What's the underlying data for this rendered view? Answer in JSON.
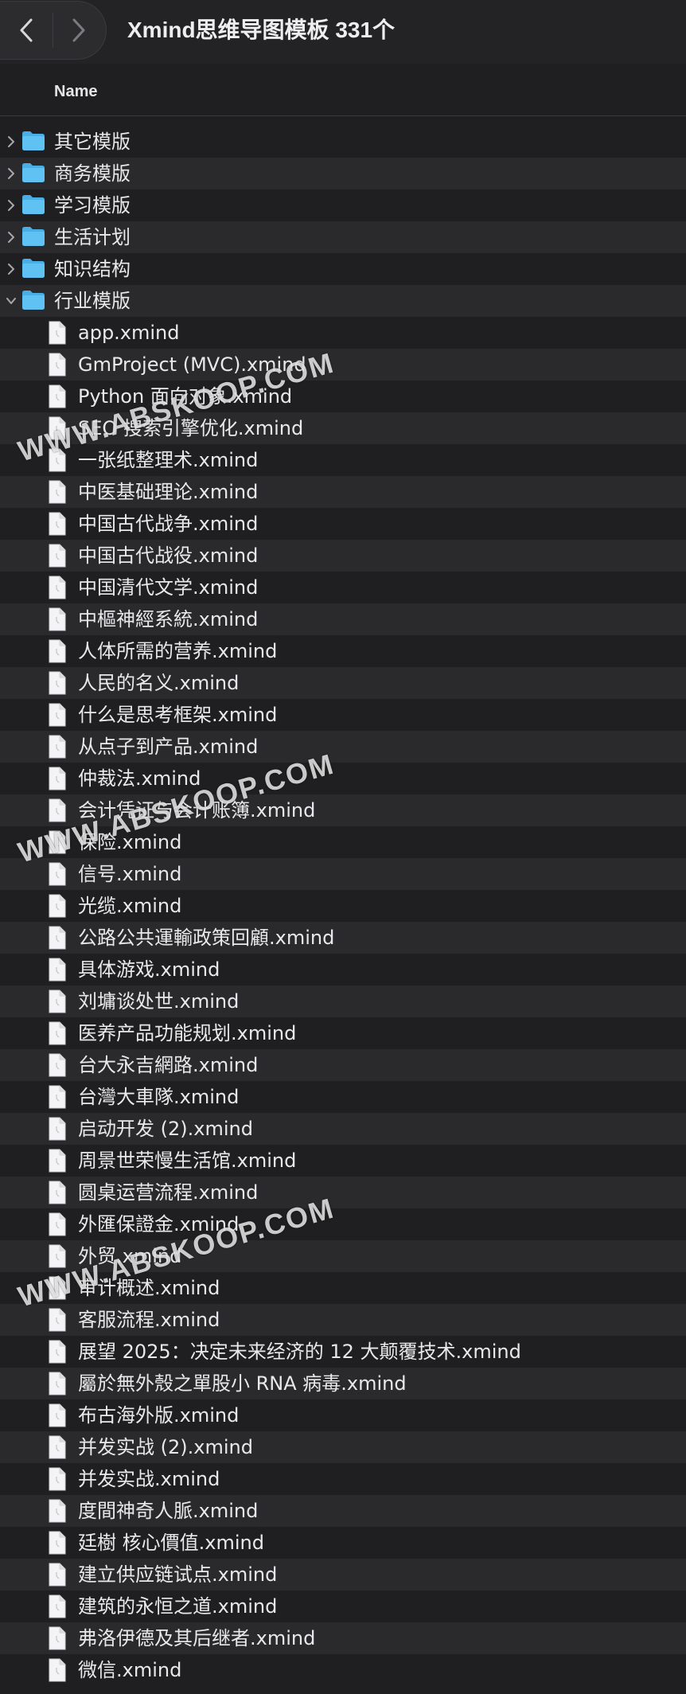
{
  "window": {
    "title": "Xmind思维导图模板 331个"
  },
  "toolbar": {
    "back_icon": "chevron-left-icon",
    "forward_icon": "chevron-right-icon"
  },
  "columns": {
    "name": "Name"
  },
  "colors": {
    "folder": "#5fc2f2",
    "folder_tab": "#49aee3",
    "background": "#1f1f21",
    "alt_row": "#2a2a2d"
  },
  "folders": [
    {
      "label": "其它模版",
      "expanded": false
    },
    {
      "label": "商务模版",
      "expanded": false
    },
    {
      "label": "学习模版",
      "expanded": false
    },
    {
      "label": "生活计划",
      "expanded": false
    },
    {
      "label": "知识结构",
      "expanded": false
    },
    {
      "label": "行业模版",
      "expanded": true
    }
  ],
  "files": [
    "app.xmind",
    "GmProject (MVC).xmind",
    "Python 面向对象.xmind",
    "SEO 搜索引擎优化.xmind",
    "一张纸整理术.xmind",
    "中医基础理论.xmind",
    "中国古代战争.xmind",
    "中国古代战役.xmind",
    "中国清代文学.xmind",
    "中樞神經系統.xmind",
    "人体所需的营养.xmind",
    "人民的名义.xmind",
    "什么是思考框架.xmind",
    "从点子到产品.xmind",
    "仲裁法.xmind",
    "会计凭证与会计账簿.xmind",
    "保险.xmind",
    "信号.xmind",
    "光缆.xmind",
    "公路公共運輸政策回顧.xmind",
    "具体游戏.xmind",
    "刘墉谈处世.xmind",
    "医养产品功能规划.xmind",
    "台大永吉網路.xmind",
    "台灣大車隊.xmind",
    "启动开发 (2).xmind",
    "周景世荣慢生活馆.xmind",
    "圆桌运营流程.xmind",
    "外匯保證金.xmind",
    "外贸.xmind",
    "审计概述.xmind",
    "客服流程.xmind",
    "展望 2025：决定未来经济的 12 大颠覆技术.xmind",
    "屬於無外殼之單股小 RNA 病毒.xmind",
    "布古海外版.xmind",
    "并发实战 (2).xmind",
    "并发实战.xmind",
    "度間神奇人脈.xmind",
    "廷樹 核心價值.xmind",
    "建立供应链试点.xmind",
    "建筑的永恒之道.xmind",
    "弗洛伊德及其后继者.xmind",
    "微信.xmind"
  ],
  "watermark": "WWW.ABSKOOP.COM"
}
